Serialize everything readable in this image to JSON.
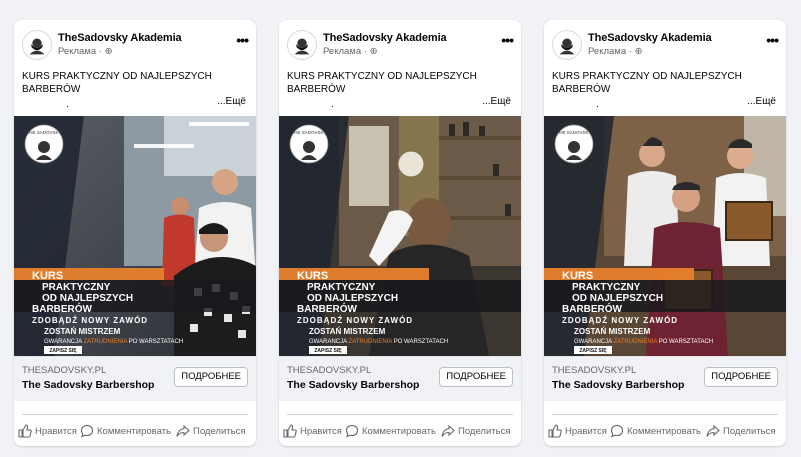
{
  "ads": [
    {
      "page_name": "TheSadovsky Akademia",
      "sponsored_label": "Реклама",
      "post_text": "KURS PRAKTYCZNY OD NAJLEPSZYCH BARBERÓW",
      "post_text_dot": ".",
      "see_more": "...Ещё",
      "banner": {
        "logo_text": "THE SADOVSKY",
        "kurs": "KURS",
        "line2": "PRAKTYCZNY",
        "line3": "OD NAJLEPSZYCH",
        "line4": "BARBERÓW",
        "line5": "ZDOBĄDŹ NOWY ZAWÓD",
        "line6": "ZOSTAŃ MISTRZEM",
        "line7_a": "GWARANCJA",
        "line7_b": "ZATRUDNIENIA",
        "line7_c": "PO WARSZTATACH",
        "button": "ZAPISZ SIĘ"
      },
      "domain": "THESADOVSKY.PL",
      "footer_name": "The Sadovsky Barbershop",
      "cta": "ПОДРОБНЕЕ",
      "actions": {
        "like": "Нравится",
        "comment": "Комментировать",
        "share": "Поделиться"
      }
    },
    {
      "page_name": "TheSadovsky Akademia",
      "sponsored_label": "Реклама",
      "post_text": "KURS PRAKTYCZNY OD NAJLEPSZYCH BARBERÓW",
      "post_text_dot": ".",
      "see_more": "...Ещё",
      "banner": {
        "logo_text": "THE SADOVSKY",
        "kurs": "KURS",
        "line2": "PRAKTYCZNY",
        "line3": "OD NAJLEPSZYCH",
        "line4": "BARBERÓW",
        "line5": "ZDOBĄDŹ NOWY ZAWÓD",
        "line6": "ZOSTAŃ MISTRZEM",
        "line7_a": "GWARANCJA",
        "line7_b": "ZATRUDNIENIA",
        "line7_c": "PO WARSZTATACH",
        "button": "ZAPISZ SIĘ"
      },
      "domain": "THESADOVSKY.PL",
      "footer_name": "The Sadovsky Barbershop",
      "cta": "ПОДРОБНЕЕ",
      "actions": {
        "like": "Нравится",
        "comment": "Комментировать",
        "share": "Поделиться"
      }
    },
    {
      "page_name": "TheSadovsky Akademia",
      "sponsored_label": "Реклама",
      "post_text": "KURS PRAKTYCZNY OD NAJLEPSZYCH BARBERÓW",
      "post_text_dot": ".",
      "see_more": "...Ещё",
      "banner": {
        "logo_text": "THE SADOVSKY",
        "kurs": "KURS",
        "line2": "PRAKTYCZNY",
        "line3": "OD NAJLEPSZYCH",
        "line4": "BARBERÓW",
        "line5": "ZDOBĄDŹ NOWY ZAWÓD",
        "line6": "ZOSTAŃ MISTRZEM",
        "line7_a": "GWARANCJA",
        "line7_b": "ZATRUDNIENIA",
        "line7_c": "PO WARSZTATACH",
        "button": "ZAPISZ SIĘ"
      },
      "domain": "THESADOVSKY.PL",
      "footer_name": "The Sadovsky Barbershop",
      "cta": "ПОДРОБНЕЕ",
      "actions": {
        "like": "Нравится",
        "comment": "Комментировать",
        "share": "Поделиться"
      }
    }
  ],
  "colors": {
    "accent_orange": "#e8812c",
    "muted": "#65676b",
    "background": "#f0f2f5"
  },
  "icons": {
    "more": "more-horizontal-icon",
    "globe": "globe-icon",
    "like": "thumbs-up-icon",
    "comment": "comment-icon",
    "share": "share-icon"
  }
}
